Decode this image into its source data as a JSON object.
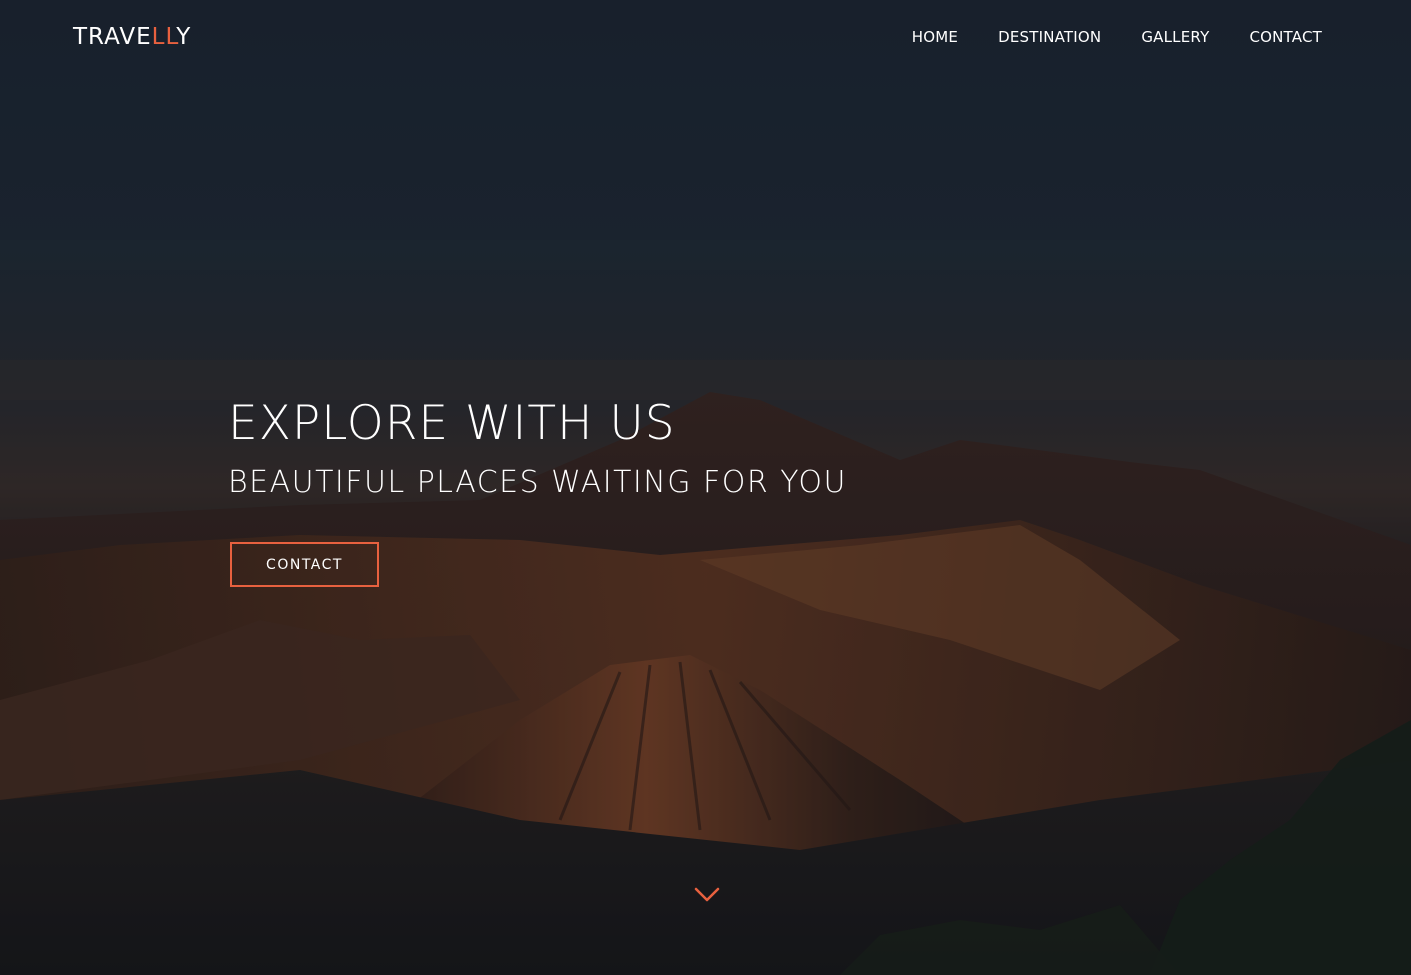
{
  "brand": {
    "logo_prefix": "TRAVE",
    "logo_accent": "LL",
    "logo_suffix": "Y",
    "accent_color": "#e8613f"
  },
  "nav": {
    "items": [
      {
        "label": "HOME"
      },
      {
        "label": "DESTINATION"
      },
      {
        "label": "GALLERY"
      },
      {
        "label": "CONTACT"
      }
    ]
  },
  "hero": {
    "title": "EXPLORE WITH US",
    "subtitle": "BEAUTIFUL PLACES WAITING FOR YOU",
    "cta_label": "CONTACT",
    "background_image": "dusk volcanic mountain landscape",
    "scroll_icon": "chevron-down-icon"
  }
}
